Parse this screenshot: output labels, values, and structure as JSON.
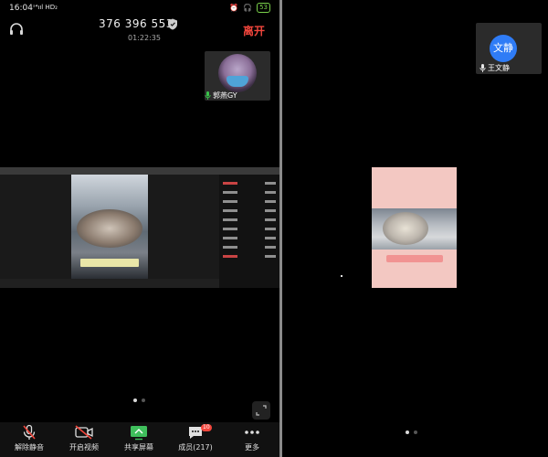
{
  "left": {
    "status_bar": {
      "time": "16:04",
      "signal": "ˢ⁴ııl HD₂",
      "battery": "53"
    },
    "header": {
      "meeting_id": "376 396 553",
      "duration": "01:22:35",
      "leave_label": "离开"
    },
    "participant_tile": {
      "name": "郭燕GY"
    },
    "page_dots": 2,
    "toolbar": [
      {
        "label": "解除静音",
        "icon": "mic-muted-icon"
      },
      {
        "label": "开启视频",
        "icon": "video-off-icon"
      },
      {
        "label": "共享屏幕",
        "icon": "share-screen-icon"
      },
      {
        "label": "成员(217)",
        "icon": "members-chat-icon",
        "badge": "10"
      },
      {
        "label": "更多",
        "icon": "more-icon"
      }
    ]
  },
  "right": {
    "participant_tile": {
      "avatar_text": "文静",
      "name": "王文静"
    },
    "page_dots": 2
  },
  "colors": {
    "leave": "#f2463c",
    "avatar_blue": "#2f7cf6",
    "background": "#000000",
    "tile": "#2b2b2b"
  }
}
